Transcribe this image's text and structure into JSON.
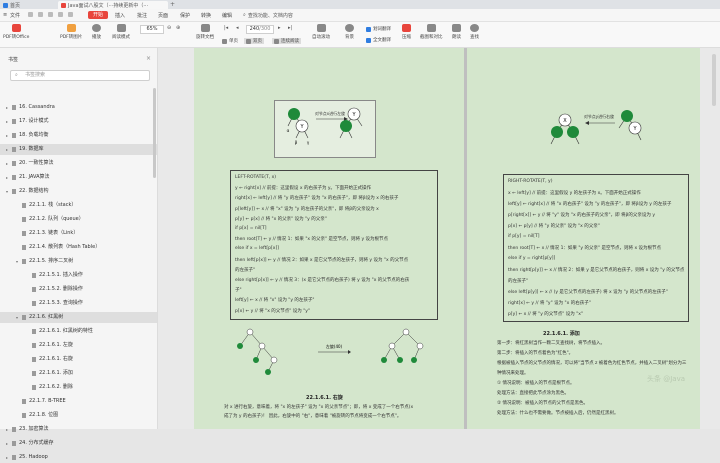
{
  "titlebar": {
    "tabs": [
      {
        "label": "首页",
        "color": "#2f7de1"
      },
      {
        "label": "Java面试八股文（···持续更新中（···",
        "color": "#e8453c"
      }
    ]
  },
  "menubar": {
    "items": [
      "文件",
      "开始",
      "插入",
      "批注",
      "页面",
      "保护",
      "转换",
      "编辑"
    ],
    "search_hint": "查找功能、文档内容"
  },
  "toolbar": {
    "pdf_to_office": "PDF转Office",
    "pdf_to_image": "PDF转图片",
    "play": "播放",
    "read_mode": "阅读模式",
    "zoom": "65%",
    "rotate": "旋转文档",
    "single_page": "单页",
    "double_page": "双页",
    "continuous_read": "连续阅读",
    "page_current": "240",
    "page_total": "/300",
    "auto_scroll": "自动滚动",
    "background": "背景",
    "full_translate": "全文翻译",
    "word_translate": "划词翻译",
    "compress": "压缩",
    "screenshot_compare": "截图和对比",
    "read_aloud": "朗读",
    "find": "查找"
  },
  "sidebar": {
    "title": "书签",
    "search_placeholder": "书签搜索",
    "items": [
      {
        "label": "16. Cassandra",
        "level": 0,
        "open": false
      },
      {
        "label": "17. 设计模式",
        "level": 0,
        "open": false
      },
      {
        "label": "18. 负载均衡",
        "level": 0,
        "open": false
      },
      {
        "label": "19. 数据库",
        "level": 0,
        "open": false,
        "selected": true
      },
      {
        "label": "20. 一致性算法",
        "level": 0,
        "open": false
      },
      {
        "label": "21. JAVA算法",
        "level": 0,
        "open": false
      },
      {
        "label": "22. 数据结构",
        "level": 0,
        "open": true
      },
      {
        "label": "22.1.1. 栈（stack）",
        "level": 1,
        "open": null
      },
      {
        "label": "22.1.2. 队列（queue）",
        "level": 1,
        "open": null
      },
      {
        "label": "22.1.3. 链表（Link）",
        "level": 1,
        "open": null
      },
      {
        "label": "22.1.4. 散列表（Hash Table）",
        "level": 1,
        "open": null
      },
      {
        "label": "22.1.5. 排序二叉树",
        "level": 1,
        "open": true
      },
      {
        "label": "22.1.5.1. 插入操作",
        "level": 2,
        "open": null
      },
      {
        "label": "22.1.5.2. 删除操作",
        "level": 2,
        "open": null
      },
      {
        "label": "22.1.5.3. 查询操作",
        "level": 2,
        "open": null
      },
      {
        "label": "22.1.6. 红黑树",
        "level": 1,
        "open": true,
        "selected": true
      },
      {
        "label": "22.1.6.1. 红黑树的特性",
        "level": 2,
        "open": null
      },
      {
        "label": "22.1.6.1. 左旋",
        "level": 2,
        "open": null
      },
      {
        "label": "22.1.6.1. 右旋",
        "level": 2,
        "open": null
      },
      {
        "label": "22.1.6.1. 添加",
        "level": 2,
        "open": null
      },
      {
        "label": "22.1.6.2. 删除",
        "level": 2,
        "open": null
      },
      {
        "label": "22.1.7. B-TREE",
        "level": 1,
        "open": null
      },
      {
        "label": "22.1.8. 位图",
        "level": 1,
        "open": null
      },
      {
        "label": "23. 加密算法",
        "level": 0,
        "open": false
      },
      {
        "label": "24. 分布式缓存",
        "level": 0,
        "open": false
      },
      {
        "label": "25. Hadoop",
        "level": 0,
        "open": false
      }
    ]
  },
  "left_page": {
    "diagram_label": "对节点x进行左旋",
    "code_lines": [
      "LEFT-ROTATE(T, x)",
      "y ← right[x]        // 前提：这里假设 x 的右孩子为 y。下面开始正式操作",
      "right[x] ← left[y]     // 将 \"y 的左孩子\" 设为 \"x 的右孩子\"，即 将β设为 x 的右孩子",
      "p[left[y]] ← x       // 将 \"x\" 设为 \"y 的左孩子的父亲\"，即 将β的父亲设为 x",
      "p[y] ← p[x]        // 将 \"x 的父亲\" 设为 \"y 的父亲\"",
      "if p[x] = nil[T]",
      "then root[T] ← y        // 情况 1：如果 \"x 的父亲\" 是空节点，则将 y 设为根节点",
      "else if x = left[p[x]]",
      "then left[p[x]] ← y   // 情况 2：如果 x 是它父节点的左孩子，则将 y 设为 \"x 的父节点",
      "的左孩子\"",
      "else right[p[x]] ← y  // 情况 3：(x 是它父节点的右孩子) 将 y 设为 \"x 的父节点的右孩",
      "子\"",
      "left[y] ← x         // 将 \"x\" 设为 \"y 的左孩子\"",
      "p[x] ← y           // 将 \"x 的父节点\" 设为 \"y\""
    ],
    "figure_mid_label": "左旋(40)",
    "section_title": "22.1.6.1.  右旋",
    "para_lines": [
      "对 x 进行右旋，意味着，将 \"x 的左孩子\" 设为 \"x 的父亲节点\"；即，将 x 变成了一个右节点(x",
      "成了为 y 的右孩子)！ 因此，右旋中的 \"右\"，意味着 \"被旋转的节点将变成一个右节点\"。"
    ]
  },
  "right_page": {
    "diagram_label": "对节点y进行右旋",
    "code_lines": [
      "RIGHT-ROTATE(T, y)",
      "x ← left[y]       // 前提：这里假设 y 的左孩子为 x。下面开始正式操作",
      "left[y] ← right[x]    // 将 \"x 的右孩子\" 设为 \"y 的左孩子\"，即 将β设为 y 的左孩子",
      "p[right[x]] ← y      // 将 \"y\" 设为 \"x 的右孩子的父亲\"，即 将β的父亲设为 y",
      "p[x] ← p[y]       // 将 \"y 的父亲\" 设为 \"x 的父亲\"",
      "if p[y] = nil[T]",
      "then root[T] ← x       // 情况 1：如果 \"y 的父亲\" 是空节点，则将 x 设为根节点",
      "else if y = right[p[y]]",
      "then right[p[y]] ← x   // 情况 2：如果 y 是它父节点的右孩子，则将 x 设为 \"y 的父节点",
      "的左孩子\"",
      "else left[p[y]] ← x  // (y 是它父节点的左孩子) 将 x 设为 \"y 的父节点的左孩子\"",
      "right[x] ← y        // 将 \"y\" 设为 \"x 的右孩子\"",
      "p[y] ← x           // 将 \"y 的父节点\" 设为 \"x\""
    ],
    "section_title": "22.1.6.1.  添加",
    "para_lines": [
      "第一步：将红黑树当作一颗二叉查找树，将节点插入。",
      "第二步：将插入的节点着色为\"红色\"。",
      "根据被插入节点的父节点的情况，可以将\"当节点 z 被着色为红色节点，并插入二叉树\"划分为三",
      "种情况来处理。",
      "① 情况说明：被插入的节点是根节点。",
      "处理方法：直接把此节点涂为黑色。",
      "② 情况说明：被插入的节点的父节点是黑色。",
      "处理方法：什么也不需要做。节点被插入后，仍然是红黑树。"
    ],
    "watermark": "头条 @Java"
  },
  "tree_nodes": {
    "x": "X",
    "y": "Y",
    "alpha": "α",
    "beta": "β",
    "gamma": "γ"
  },
  "colors": {
    "accent": "#e8453c",
    "page_bg": "#d4e6cc",
    "node_green": "#1f8a3a",
    "node_white": "#ffffff"
  }
}
